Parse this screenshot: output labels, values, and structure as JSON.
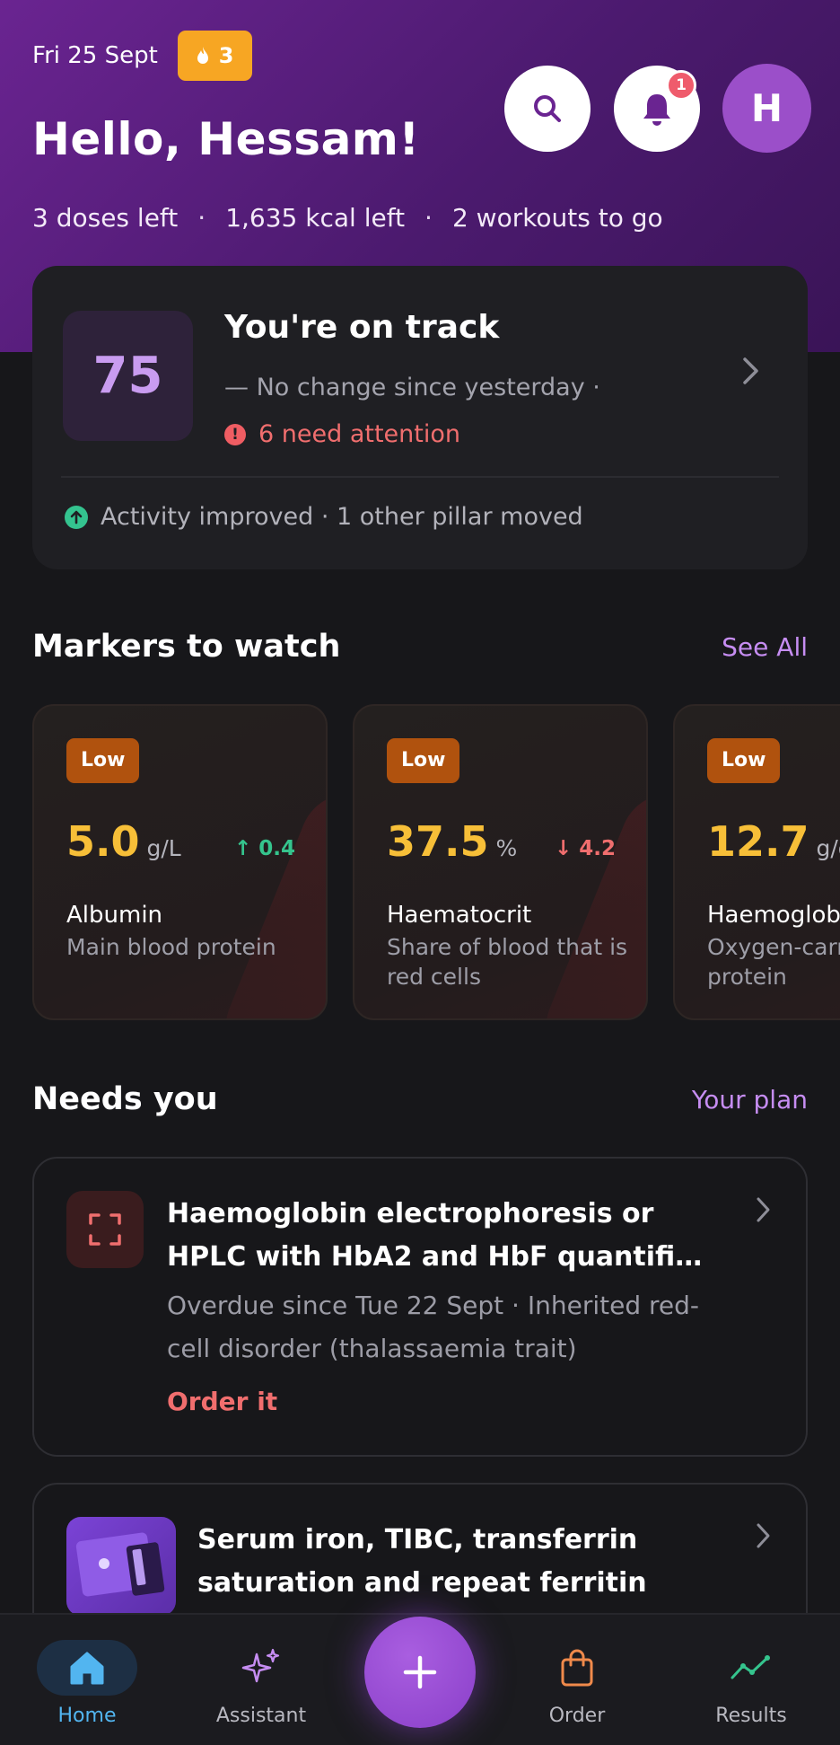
{
  "header": {
    "date": "Fri 25 Sept",
    "streak_count": "3",
    "greeting": "Hello, Hessam!",
    "summary": [
      "3 doses left",
      "1,635 kcal left",
      "2 workouts to go"
    ],
    "summary_separator": "·",
    "notification_count": "1",
    "avatar_initial": "H"
  },
  "status_card": {
    "score": "75",
    "title": "You're on track",
    "change": "— No change since yesterday ·",
    "attention": "6 need attention",
    "footer": "Activity improved · 1 other pillar moved"
  },
  "markers": {
    "title": "Markers to watch",
    "link": "See All",
    "items": [
      {
        "status": "Low",
        "value": "5.0",
        "unit": "g/L",
        "delta": "↑ 0.4",
        "direction": "up",
        "name": "Albumin",
        "description": "Main blood protein"
      },
      {
        "status": "Low",
        "value": "37.5",
        "unit": "%",
        "delta": "↓ 4.2",
        "direction": "down",
        "name": "Haematocrit",
        "description": "Share of blood that is red cells"
      },
      {
        "status": "Low",
        "value": "12.7",
        "unit": "g/dL",
        "delta": "",
        "direction": "",
        "name": "Haemoglobin",
        "description": "Oxygen-carrying protein"
      }
    ]
  },
  "needs": {
    "title": "Needs you",
    "link": "Your plan",
    "items": [
      {
        "title": "Haemoglobin electrophoresis or HPLC with HbA2 and HbF quantifi…",
        "subtitle": "Overdue since Tue 22 Sept · Inherited red-cell disorder (thalassaemia trait)",
        "action": "Order it"
      },
      {
        "title": "Serum iron, TIBC, transferrin saturation and repeat ferritin"
      }
    ]
  },
  "nav": {
    "items": [
      {
        "label": "Home",
        "icon": "home-icon"
      },
      {
        "label": "Assistant",
        "icon": "sparkles-icon"
      },
      {
        "label": "Order",
        "icon": "bag-icon"
      },
      {
        "label": "Results",
        "icon": "trend-icon"
      }
    ],
    "fab_icon": "plus-icon"
  },
  "colors": {
    "accent": "#c68df2",
    "hero": "#5a1f80",
    "warning": "#f06e6e",
    "value": "#f7bf38",
    "low_badge": "#b0520e",
    "active_nav": "#52b5f0"
  }
}
